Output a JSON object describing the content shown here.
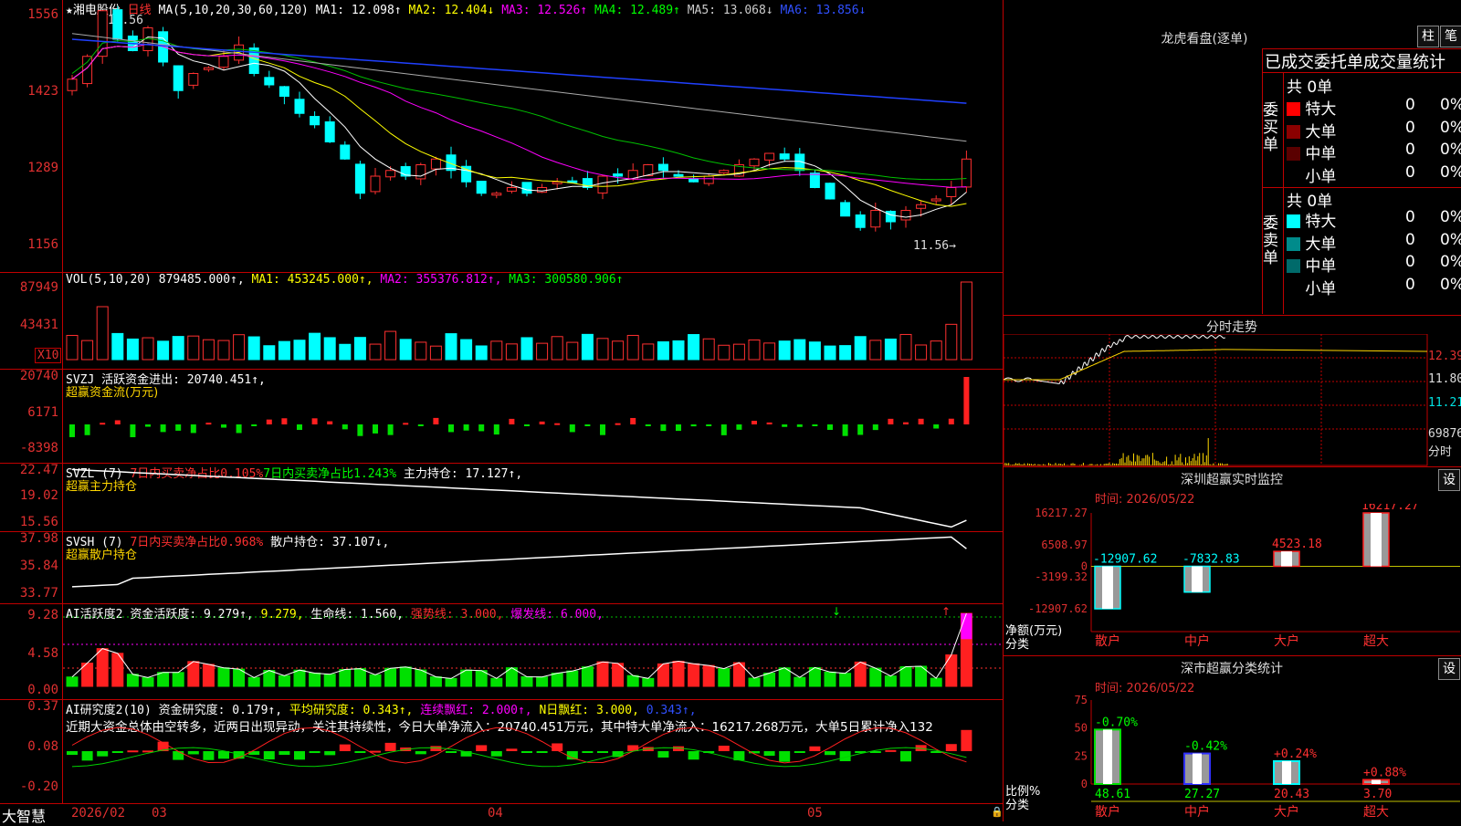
{
  "stock": {
    "name": "湘电股份",
    "period": "日线",
    "ma_header": "MA(5,10,20,30,60,120)",
    "ma1": "MA1: 12.098↑",
    "ma2": "MA2: 12.404↓",
    "ma3": "MA3: 12.526↑",
    "ma4": "MA4: 12.489↑",
    "ma5": "MA5: 13.068↓",
    "ma6": "MA6: 13.856↓",
    "price_axis": [
      "1556",
      "1423",
      "1289",
      "1156"
    ],
    "high_mark": "←15.56",
    "low_mark": "11.56→"
  },
  "volume": {
    "header": "VOL(5,10,20)",
    "value": "879485.000↑,",
    "ma1": "MA1: 453245.000↑,",
    "ma2": "MA2: 355376.812↑,",
    "ma3": "MA3: 300580.906↑",
    "axis": [
      "87949",
      "43431"
    ],
    "unit": "X10"
  },
  "svzj": {
    "header": "SVZJ  活跃资金进出: 20740.451↑,",
    "subtitle": "超赢资金流(万元)",
    "axis": [
      "20740",
      "6171",
      "-8398"
    ]
  },
  "svzl": {
    "header_a": "SVZL (7)",
    "header_b": "7日内买卖净占比0.105%",
    "header_c": "7日内买卖净占比1.243%",
    "header_d": "主力持仓: 17.127↑,",
    "subtitle": "超赢主力持仓",
    "axis": [
      "22.47",
      "19.02",
      "15.56"
    ]
  },
  "svsh": {
    "header_a": "SVSH (7)",
    "header_b": "7日内买卖净占比0.968%",
    "header_c": "散户持仓: 37.107↓,",
    "subtitle": "超赢散户持仓",
    "axis": [
      "37.98",
      "35.84",
      "33.77"
    ]
  },
  "ai_active": {
    "header_a": "AI活跃度2",
    "header_b": "资金活跃度: 9.279↑,",
    "header_c": "9.279,",
    "header_d": "生命线: 1.560,",
    "header_e": "强势线: 3.000,",
    "header_f": "爆发线: 6.000,",
    "axis": [
      "9.28",
      "4.58",
      "0.00"
    ]
  },
  "ai_research": {
    "header_a": "AI研究度2(10)",
    "header_b": "资金研究度: 0.179↑,",
    "header_c": "平均研究度: 0.343↑,",
    "header_d": "连续飘红: 2.000↑,",
    "header_e": "N日飘红: 3.000,",
    "header_f": "0.343↑,",
    "comment": "近期大资金总体由空转多，近两日出现异动，关注其持续性，今日大单净流入：20740.451万元，其中特大单净流入：16217.268万元，大单5日累计净入132",
    "axis": [
      "0.37",
      "0.08",
      "-0.20"
    ]
  },
  "bottom_axis": {
    "brand": "大智慧",
    "labels": [
      "2026/02",
      "03",
      "04",
      "05"
    ]
  },
  "dragon_tiger": {
    "title": "龙虎看盘(逐单)",
    "btn_bar": "柱",
    "btn_tick": "笔",
    "section_title": "已成交委托单成交量统计",
    "buy_label": "委买单",
    "sell_label": "委卖单",
    "buy_total": "共 0单",
    "sell_total": "共 0单",
    "buy_rows": [
      {
        "label": "特大",
        "count": "0",
        "pct": "0%",
        "color": "#ff0000"
      },
      {
        "label": "大单",
        "count": "0",
        "pct": "0%",
        "color": "#8b0000"
      },
      {
        "label": "中单",
        "count": "0",
        "pct": "0%",
        "color": "#5a0000"
      },
      {
        "label": "小单",
        "count": "0",
        "pct": "0%",
        "color": ""
      }
    ],
    "sell_rows": [
      {
        "label": "特大",
        "count": "0",
        "pct": "0%",
        "color": "#00ffff"
      },
      {
        "label": "大单",
        "count": "0",
        "pct": "0%",
        "color": "#008b8b"
      },
      {
        "label": "中单",
        "count": "0",
        "pct": "0%",
        "color": "#006a6a"
      },
      {
        "label": "小单",
        "count": "0",
        "pct": "0%",
        "color": ""
      }
    ]
  },
  "intraday": {
    "title": "分时走势",
    "price_labels": [
      "12.39",
      "11.80",
      "11.21"
    ],
    "volume_label": "69876",
    "tab": "分时"
  },
  "sz_monitor": {
    "title": "深圳超赢实时监控",
    "settings": "设",
    "time": "时间: 2026/05/22",
    "axis": [
      "16217.27",
      "6508.97",
      "0",
      "-3199.32",
      "-12907.62"
    ],
    "axis_label_a": "净额(万元)",
    "axis_label_b": "分类",
    "chart_data": {
      "type": "bar",
      "categories": [
        "散户",
        "中户",
        "大户",
        "超大"
      ],
      "values": [
        -12907.62,
        -7832.83,
        4523.18,
        16217.27
      ],
      "value_labels": [
        "-12907.62",
        "-7832.83",
        "4523.18",
        "16217.27"
      ],
      "ylim": [
        -12907.62,
        16217.27
      ]
    }
  },
  "sz_classify": {
    "title": "深市超赢分类统计",
    "settings": "设",
    "time": "时间: 2026/05/22",
    "axis": [
      "75",
      "50",
      "25",
      "0"
    ],
    "axis_label_a": "比例%",
    "axis_label_b": "分类",
    "chart_data": {
      "type": "bar",
      "categories": [
        "散户",
        "中户",
        "大户",
        "超大"
      ],
      "values": [
        48.61,
        27.27,
        20.43,
        3.7
      ],
      "value_labels": [
        "48.61",
        "27.27",
        "20.43",
        "3.70"
      ],
      "change_labels": [
        "-0.70%",
        "-0.42%",
        "+0.24%",
        "+0.88%"
      ],
      "ylim": [
        0,
        75
      ]
    }
  }
}
